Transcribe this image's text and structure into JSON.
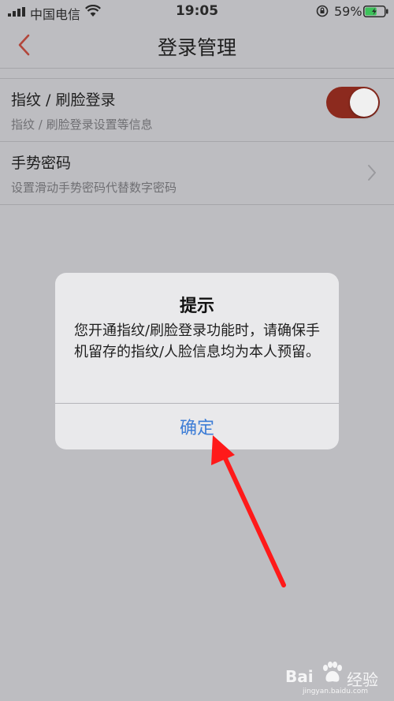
{
  "status_bar": {
    "carrier": "中国电信",
    "time": "19:05",
    "battery_percent": "59%",
    "battery_level": 0.59
  },
  "nav": {
    "title": "登录管理"
  },
  "settings": [
    {
      "title": "指纹 / 刷脸登录",
      "subtitle": "指纹 / 刷脸登录设置等信息",
      "toggle_on": true
    },
    {
      "title": "手势密码",
      "subtitle": "设置滑动手势密码代替数字密码"
    }
  ],
  "dialog": {
    "title": "提示",
    "message": "您开通指纹/刷脸登录功能时，请确保手机留存的指纹/人脸信息均为本人预留。",
    "confirm_label": "确定"
  },
  "watermark": {
    "brand": "Bai",
    "brand_suffix": "经验",
    "url": "jingyan.baidu.com"
  },
  "colors": {
    "accent": "#8c2a1e",
    "link_blue": "#3d7dd6",
    "annotation_red": "#ff1a1a",
    "background": "#bdbdc1"
  }
}
